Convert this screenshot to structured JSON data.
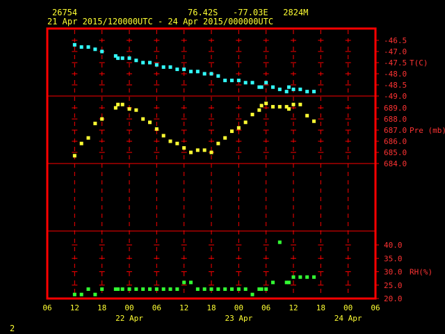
{
  "header": {
    "station": "26754",
    "location": "76.42S   -77.03E   2824M",
    "period": "21 Apr 2015/120000UTC - 24 Apr 2015/000000UTC"
  },
  "page_number": "2",
  "colors": {
    "frame": "#ff0000",
    "temperature": "#33ffff",
    "pressure": "#ffff33",
    "rh": "#33ff33",
    "labels": "#ffff33",
    "panel_labels": "#ff3333"
  },
  "chart_data": {
    "type": "scatter",
    "x_tick_labels": [
      "06",
      "12",
      "18",
      "00",
      "06",
      "12",
      "18",
      "00",
      "06",
      "12",
      "18",
      "00",
      "06"
    ],
    "date_labels": [
      "22 Apr",
      "23 Apr",
      "24 Apr"
    ],
    "x_unit": "hours since 21 Apr 2015 06UTC",
    "x_range": [
      0,
      72
    ],
    "panels": [
      {
        "name": "T(C)",
        "ylim": [
          -49.0,
          -46.5
        ],
        "ticks": [
          "-46.5",
          "-47.0",
          "-47.5",
          "-48.0",
          "-48.5",
          "-49.0"
        ],
        "tick_values": [
          -46.5,
          -47.0,
          -47.5,
          -48.0,
          -48.5,
          -49.0
        ],
        "label_at": -47.5,
        "series": {
          "name": "T(C)",
          "x": [
            6,
            7.5,
            9,
            10.5,
            12,
            15,
            15.5,
            16.5,
            18,
            19.5,
            21,
            22.5,
            24,
            25.5,
            27,
            28.5,
            30,
            31.5,
            33,
            34.5,
            36,
            37.5,
            39,
            40.5,
            42,
            43.5,
            45,
            46.5,
            47,
            48,
            49.5,
            51,
            52.5,
            53,
            54,
            55.5,
            57,
            58.5
          ],
          "values": [
            -46.7,
            -46.8,
            -46.8,
            -46.9,
            -47.0,
            -47.2,
            -47.3,
            -47.3,
            -47.3,
            -47.4,
            -47.5,
            -47.5,
            -47.6,
            -47.7,
            -47.7,
            -47.8,
            -47.8,
            -47.9,
            -47.9,
            -48.0,
            -48.0,
            -48.1,
            -48.3,
            -48.3,
            -48.3,
            -48.4,
            -48.4,
            -48.6,
            -48.6,
            -48.4,
            -48.6,
            -48.7,
            -48.8,
            -48.6,
            -48.7,
            -48.7,
            -48.8,
            -48.8
          ]
        }
      },
      {
        "name": "Pre (mb)",
        "ylim": [
          684.0,
          689.0
        ],
        "ticks": [
          "689.0",
          "688.0",
          "687.0",
          "686.0",
          "685.0",
          "684.0"
        ],
        "tick_values": [
          689,
          688,
          687,
          686,
          685,
          684
        ],
        "label_at": 687.0,
        "series": {
          "name": "Pre (mb)",
          "x": [
            6,
            7.5,
            9,
            10.5,
            12,
            15,
            15.5,
            16.5,
            18,
            19.5,
            21,
            22.5,
            24,
            25.5,
            27,
            28.5,
            30,
            31.5,
            33,
            34.5,
            36,
            37.5,
            39,
            40.5,
            42,
            43.5,
            45,
            46.5,
            47,
            48,
            49.5,
            51,
            52.5,
            53,
            54,
            55.5,
            57,
            58.5
          ],
          "values": [
            684.7,
            685.8,
            686.3,
            687.6,
            688.0,
            689.0,
            689.3,
            689.3,
            688.9,
            688.8,
            688.0,
            687.7,
            687.1,
            686.5,
            686.0,
            685.8,
            685.4,
            685.0,
            685.2,
            685.2,
            685.0,
            685.8,
            686.3,
            686.9,
            687.2,
            687.7,
            688.4,
            688.8,
            689.2,
            689.4,
            689.1,
            689.1,
            689.1,
            688.9,
            689.3,
            689.3,
            688.3,
            687.8
          ]
        }
      },
      {
        "name": "blank",
        "ylim": [
          0,
          1
        ],
        "ticks": [],
        "tick_values": [],
        "series": {
          "name": "",
          "x": [],
          "values": []
        }
      },
      {
        "name": "RH(%)",
        "ylim": [
          20.0,
          40.0
        ],
        "ticks": [
          "40.0",
          "35.0",
          "30.0",
          "25.0",
          "20.0"
        ],
        "tick_values": [
          40,
          35,
          30,
          25,
          20
        ],
        "label_at": 30.0,
        "series": {
          "name": "RH(%)",
          "x": [
            6,
            7.5,
            9,
            10.5,
            12,
            15,
            15.5,
            16.5,
            18,
            19.5,
            21,
            22.5,
            24,
            25.5,
            27,
            28.5,
            30,
            31.5,
            33,
            34.5,
            36,
            37.5,
            39,
            40.5,
            42,
            43.5,
            45,
            46.5,
            47,
            48,
            49.5,
            51,
            52.5,
            53,
            54,
            55.5,
            57,
            58.5
          ],
          "values": [
            21.5,
            21.5,
            23.5,
            21.5,
            23.5,
            23.5,
            23.5,
            23.5,
            23.5,
            23.5,
            23.5,
            23.5,
            23.5,
            23.5,
            23.5,
            23.5,
            26.0,
            26.0,
            23.5,
            23.5,
            23.5,
            23.5,
            23.5,
            23.5,
            23.5,
            23.5,
            21.5,
            23.5,
            23.5,
            23.5,
            26.0,
            41.0,
            26.0,
            26.0,
            28.0,
            28.0,
            28.0,
            28.0
          ]
        }
      }
    ]
  }
}
